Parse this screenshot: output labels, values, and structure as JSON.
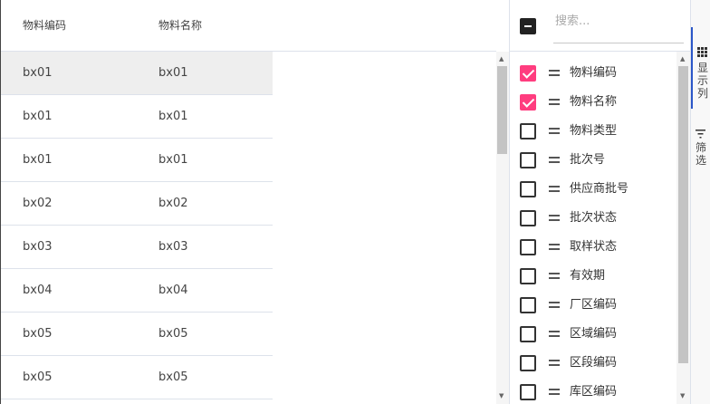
{
  "grid": {
    "columns": [
      "物料编码",
      "物料名称"
    ],
    "rows": [
      {
        "code": "bx01",
        "name": "bx01",
        "selected": true
      },
      {
        "code": "bx01",
        "name": "bx01",
        "selected": false
      },
      {
        "code": "bx01",
        "name": "bx01",
        "selected": false
      },
      {
        "code": "bx02",
        "name": "bx02",
        "selected": false
      },
      {
        "code": "bx03",
        "name": "bx03",
        "selected": false
      },
      {
        "code": "bx04",
        "name": "bx04",
        "selected": false
      },
      {
        "code": "bx05",
        "name": "bx05",
        "selected": false
      },
      {
        "code": "bx05",
        "name": "bx05",
        "selected": false
      }
    ]
  },
  "column_panel": {
    "search_placeholder": "搜索...",
    "select_all_state": "indeterminate",
    "columns": [
      {
        "label": "物料编码",
        "checked": true
      },
      {
        "label": "物料名称",
        "checked": true
      },
      {
        "label": "物料类型",
        "checked": false
      },
      {
        "label": "批次号",
        "checked": false
      },
      {
        "label": "供应商批号",
        "checked": false
      },
      {
        "label": "批次状态",
        "checked": false
      },
      {
        "label": "取样状态",
        "checked": false
      },
      {
        "label": "有效期",
        "checked": false
      },
      {
        "label": "厂区编码",
        "checked": false
      },
      {
        "label": "区域编码",
        "checked": false
      },
      {
        "label": "区段编码",
        "checked": false
      },
      {
        "label": "库区编码",
        "checked": false
      }
    ]
  },
  "sidebar": {
    "columns_tab_label": "显示列",
    "filters_tab_label": "筛选",
    "columns_tab_icon": "grid-icon",
    "filters_tab_icon": "filter-icon"
  },
  "colors": {
    "checked": "#ff3d7f",
    "active_tab": "#2b56c8",
    "selected_row": "#eeeeee"
  }
}
